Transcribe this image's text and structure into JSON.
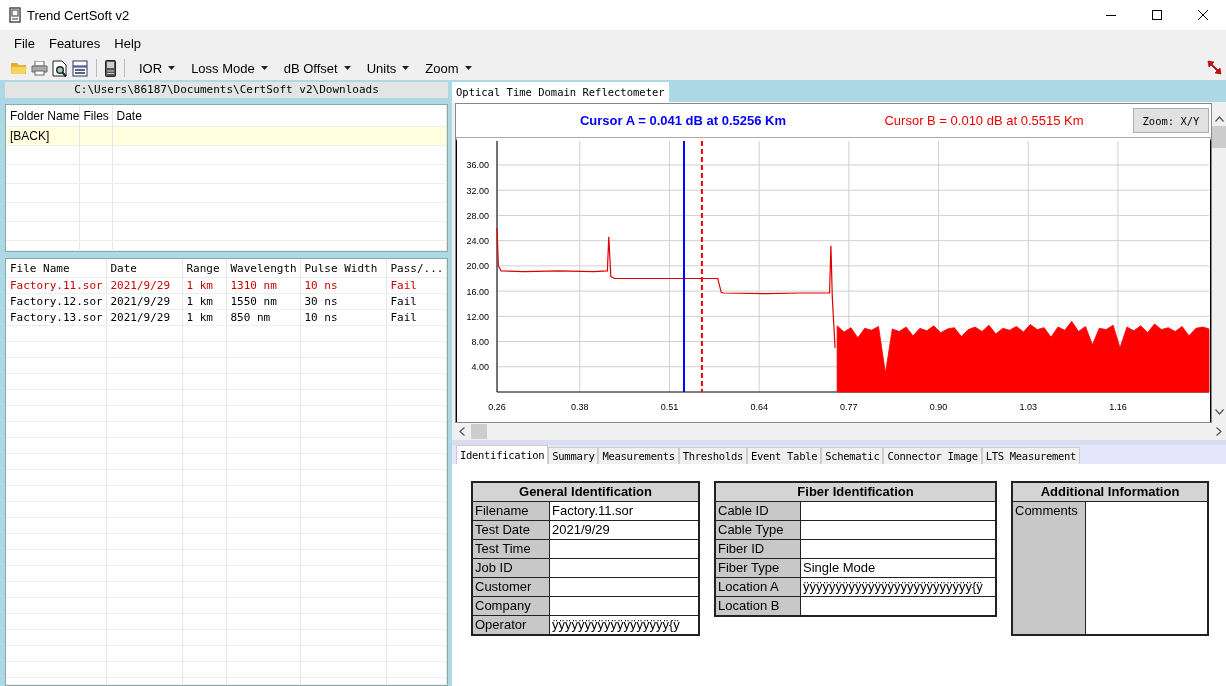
{
  "window": {
    "title": "Trend CertSoft v2"
  },
  "menu": [
    "File",
    "Features",
    "Help"
  ],
  "toolbar": {
    "dropdowns": [
      "IOR",
      "Loss Mode",
      "dB Offset",
      "Units",
      "Zoom"
    ]
  },
  "folder_path": "C:\\Users\\86187\\Documents\\CertSoft v2\\Downloads",
  "folder_table": {
    "columns": [
      "Folder Name",
      "Files",
      "Date"
    ],
    "rows": [
      {
        "name": "[BACK]",
        "selected": true
      }
    ]
  },
  "file_table": {
    "columns": [
      "File Name",
      "Date",
      "Range",
      "Wavelength",
      "Pulse Width",
      "Pass/..."
    ],
    "rows": [
      {
        "cells": [
          "Factory.11.sor",
          "2021/9/29",
          "1 km",
          "1310 nm",
          "10 ns",
          "Fail"
        ],
        "selected": true
      },
      {
        "cells": [
          "Factory.12.sor",
          "2021/9/29",
          "1 km",
          "1550 nm",
          "30 ns",
          "Fail"
        ],
        "selected": false
      },
      {
        "cells": [
          "Factory.13.sor",
          "2021/9/29",
          "1 km",
          "850 nm",
          "10 ns",
          "Fail"
        ],
        "selected": false
      }
    ]
  },
  "main_tab": {
    "label": "Optical Time Domain Reflectometer",
    "selected": true
  },
  "cursors": [
    {
      "text": "Cursor A = 0.041 dB at 0.5256 Km",
      "color": "#0000ff"
    },
    {
      "text": "Cursor B = 0.010 dB at 0.5515 Km",
      "color": "#ee0000"
    }
  ],
  "zoom_button": "Zoom: X/Y",
  "chart_data": {
    "type": "line",
    "grid": true,
    "xlim": [
      0.26,
      1.292
    ],
    "ylim": [
      0,
      39.8
    ],
    "ref_lines": [
      {
        "axis": "x",
        "value": 0.531,
        "color": "#0000ff"
      },
      {
        "axis": "x",
        "value": 0.557,
        "color": "#ee0000"
      }
    ],
    "xticks": [
      0.26,
      0.38,
      0.51,
      0.64,
      0.77,
      {
        "value": 0.9,
        "label": "0.90"
      },
      1.03,
      1.16
    ],
    "yticks": [
      {
        "value": 4,
        "label": "4.00"
      },
      {
        "value": 8,
        "label": "8.00"
      },
      {
        "value": 12,
        "label": "12.00"
      },
      {
        "value": 16,
        "label": "16.00"
      },
      {
        "value": 20,
        "label": "20.00"
      },
      {
        "value": 24,
        "label": "24.00"
      },
      {
        "value": 28,
        "label": "28.00"
      },
      {
        "value": 32,
        "label": "32.00"
      },
      {
        "value": 36,
        "label": "36.00"
      }
    ],
    "x": [
      0.26,
      0.262,
      0.266,
      0.3,
      0.35,
      0.4,
      0.42,
      0.422,
      0.425,
      0.43,
      0.5,
      0.58,
      0.585,
      0.588,
      0.65,
      0.7,
      0.742,
      0.744,
      0.746,
      0.75,
      0.753,
      0.763,
      0.773,
      0.783,
      0.793,
      0.803,
      0.813,
      0.823,
      0.833,
      0.843,
      0.853,
      0.863,
      0.873,
      0.883,
      0.893,
      0.903,
      0.913,
      0.923,
      0.933,
      0.943,
      0.953,
      0.963,
      0.973,
      0.983,
      0.993,
      1.003,
      1.013,
      1.023,
      1.033,
      1.043,
      1.053,
      1.063,
      1.073,
      1.083,
      1.093,
      1.103,
      1.113,
      1.123,
      1.133,
      1.143,
      1.153,
      1.163,
      1.173,
      1.183,
      1.193,
      1.203,
      1.213,
      1.223,
      1.233,
      1.243,
      1.253,
      1.263,
      1.273,
      1.283,
      1.292
    ],
    "series": [
      {
        "type": "line",
        "color": "#dd0000",
        "values": [
          26,
          20,
          19.2,
          19.1,
          19.2,
          19.1,
          19.2,
          24.6,
          18.3,
          18,
          18,
          18,
          15.8,
          15.7,
          15.6,
          15.7,
          15.7,
          23.2,
          15,
          7,
          null,
          null,
          null,
          null,
          null,
          null,
          null,
          null,
          null,
          null,
          null,
          null,
          null,
          null,
          null,
          null,
          null,
          null,
          null,
          null,
          null,
          null,
          null,
          null,
          null,
          null,
          null,
          null,
          null,
          null,
          null,
          null,
          null,
          null,
          null,
          null,
          null,
          null,
          null,
          null,
          null,
          null,
          null,
          null,
          null,
          null,
          null,
          null,
          null,
          null,
          null,
          null,
          null,
          null,
          null
        ]
      },
      {
        "type": "area",
        "color": "#ff0000",
        "values": [
          null,
          null,
          null,
          null,
          null,
          null,
          null,
          null,
          null,
          null,
          null,
          null,
          null,
          null,
          null,
          null,
          null,
          null,
          null,
          null,
          10.5,
          9.5,
          10.2,
          8.6,
          10.1,
          9.8,
          10.4,
          3,
          10,
          9.6,
          10.3,
          8.9,
          10.1,
          9.7,
          10.5,
          9.4,
          10,
          10.2,
          8.8,
          9.9,
          10.3,
          9.6,
          10.6,
          9.2,
          10.1,
          9.8,
          10.4,
          9.5,
          10.7,
          9.9,
          10.2,
          8.7,
          10.3,
          9.8,
          11.2,
          9.6,
          10.4,
          7.5,
          10.1,
          9.9,
          10.6,
          7,
          10.3,
          9.7,
          10.5,
          9.4,
          10.8,
          9.9,
          10.2,
          9.6,
          10.4,
          8.9,
          10.1,
          10.3,
          10
        ]
      }
    ]
  },
  "detail_tabs": [
    {
      "label": "Identification",
      "selected": true
    },
    {
      "label": "Summary",
      "selected": false
    },
    {
      "label": "Measurements",
      "selected": false
    },
    {
      "label": "Thresholds",
      "selected": false
    },
    {
      "label": "Event Table",
      "selected": false
    },
    {
      "label": "Schematic",
      "selected": false
    },
    {
      "label": "Connector Image",
      "selected": false
    },
    {
      "label": "LTS Measurement",
      "selected": false
    }
  ],
  "general_identification": {
    "title": "General Identification",
    "rows": [
      {
        "label": "Filename",
        "value": "Factory.11.sor"
      },
      {
        "label": "Test Date",
        "value": "2021/9/29"
      },
      {
        "label": "Test Time"
      },
      {
        "label": "Job ID"
      },
      {
        "label": "Customer"
      },
      {
        "label": "Company"
      },
      {
        "label": "Operator",
        "value": "ÿÿÿÿÿÿÿÿÿÿÿÿÿÿÿÿÿÿ{ÿ"
      }
    ]
  },
  "fiber_identification": {
    "title": "Fiber Identification",
    "rows": [
      {
        "label": "Cable ID"
      },
      {
        "label": "Cable Type"
      },
      {
        "label": "Fiber ID"
      },
      {
        "label": "Fiber Type",
        "value": "Single Mode"
      },
      {
        "label": "Location A",
        "value": "ÿÿÿÿÿÿÿÿÿÿÿÿÿÿÿÿÿÿÿÿÿÿÿÿÿÿ{ÿ"
      },
      {
        "label": "Location B"
      }
    ]
  },
  "additional_information": {
    "title": "Additional Information",
    "rows": [
      {
        "label": "Comments"
      }
    ]
  }
}
